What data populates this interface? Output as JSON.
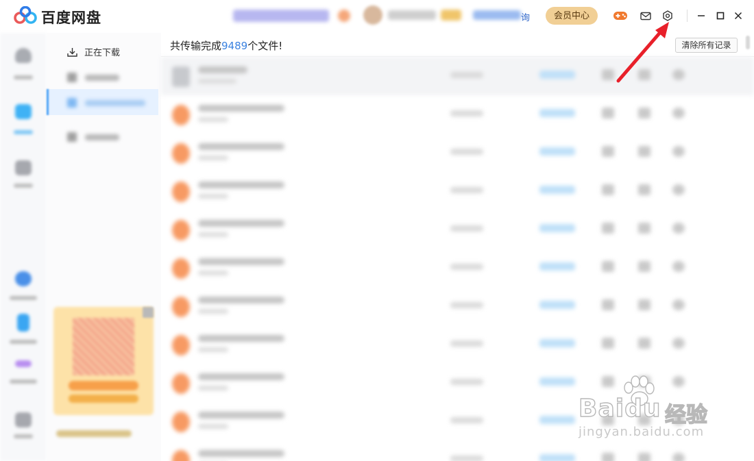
{
  "app": {
    "name": "百度网盘",
    "link_tail": "询",
    "member_center": "会员中心",
    "icons": [
      "baidu-netdisk-logo",
      "game-icon",
      "mail-icon",
      "gear-icon",
      "minimize-icon",
      "maximize-icon",
      "close-icon"
    ],
    "brand_colors": {
      "blue": "#3b82e0",
      "member_gold": "#f1cf95",
      "game_orange": "#f0792e",
      "annotation_red": "#e8202a"
    }
  },
  "sidebar": {
    "downloading_label": "正在下载"
  },
  "main": {
    "summary_prefix": "共传输完成",
    "summary_count": "9489",
    "summary_suffix": "个文件!",
    "clear_button": "清除所有记录"
  },
  "watermark": {
    "brand": "Baidu",
    "brand_cn": "经验",
    "url": "jingyan.baidu.com"
  }
}
